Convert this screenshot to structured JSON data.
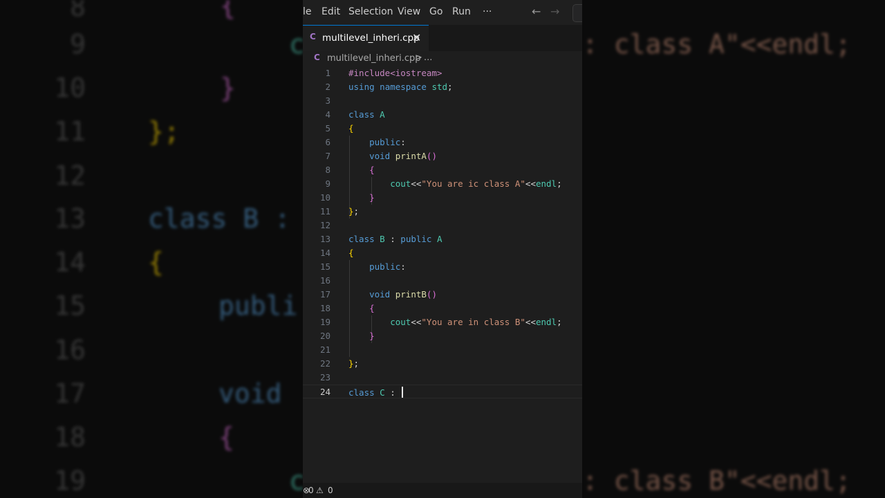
{
  "background_left": {
    "line_numbers": [
      "8",
      "9",
      "10",
      "11",
      "12",
      "13",
      "14",
      "15",
      "16",
      "17",
      "18",
      "19"
    ],
    "fragments": {
      "brace_open_8": "{",
      "c_9": "c",
      "brace_close_10": "}",
      "semi_11": "};",
      "class_b_13": "class B :",
      "brace_open_14": "{",
      "publi_15": "publi",
      "void_17": "void",
      "brace_open_18": "{",
      "c_19": "c"
    }
  },
  "background_right": {
    "line_9": "class A\"<<endl;",
    "line_19": "class B\"<<endl;"
  },
  "menubar": {
    "items": [
      "le",
      "Edit",
      "Selection",
      "View",
      "Go",
      "Run",
      "···"
    ],
    "back_icon": "←",
    "forward_icon": "→"
  },
  "tab": {
    "lang_badge": "C",
    "filename": "multilevel_inheri.cpp",
    "close_icon": "✕"
  },
  "breadcrumb": {
    "lang_badge": "C",
    "filename": "multilevel_inheri.cpp",
    "separator": ">",
    "more": "..."
  },
  "editor": {
    "active_line": 24,
    "lines": [
      {
        "n": "1",
        "text": "#include<iostream>"
      },
      {
        "n": "2",
        "text": "using namespace std;"
      },
      {
        "n": "3",
        "text": ""
      },
      {
        "n": "4",
        "text": "class A"
      },
      {
        "n": "5",
        "text": "{"
      },
      {
        "n": "6",
        "text": "    public:"
      },
      {
        "n": "7",
        "text": "    void printA()"
      },
      {
        "n": "8",
        "text": "    {"
      },
      {
        "n": "9",
        "text": "        cout<<\"You are ic class A\"<<endl;"
      },
      {
        "n": "10",
        "text": "    }"
      },
      {
        "n": "11",
        "text": "};"
      },
      {
        "n": "12",
        "text": ""
      },
      {
        "n": "13",
        "text": "class B : public A"
      },
      {
        "n": "14",
        "text": "{"
      },
      {
        "n": "15",
        "text": "    public:"
      },
      {
        "n": "16",
        "text": ""
      },
      {
        "n": "17",
        "text": "    void printB()"
      },
      {
        "n": "18",
        "text": "    {"
      },
      {
        "n": "19",
        "text": "        cout<<\"You are in class B\"<<endl;"
      },
      {
        "n": "20",
        "text": "    }"
      },
      {
        "n": "21",
        "text": ""
      },
      {
        "n": "22",
        "text": "};"
      },
      {
        "n": "23",
        "text": ""
      },
      {
        "n": "24",
        "text": "class C : "
      }
    ]
  },
  "statusbar": {
    "errors_icon": "⊗",
    "errors": "0",
    "warnings_icon": "⚠",
    "warnings": "0"
  },
  "colors": {
    "keyword": "#569cd6",
    "preprocessor": "#c586c0",
    "string": "#ce9178",
    "function": "#dcdcaa",
    "brace_l1": "#ffd700",
    "brace_l2": "#da70d6",
    "type": "#4ec9b0",
    "default": "#d4d4d4"
  }
}
